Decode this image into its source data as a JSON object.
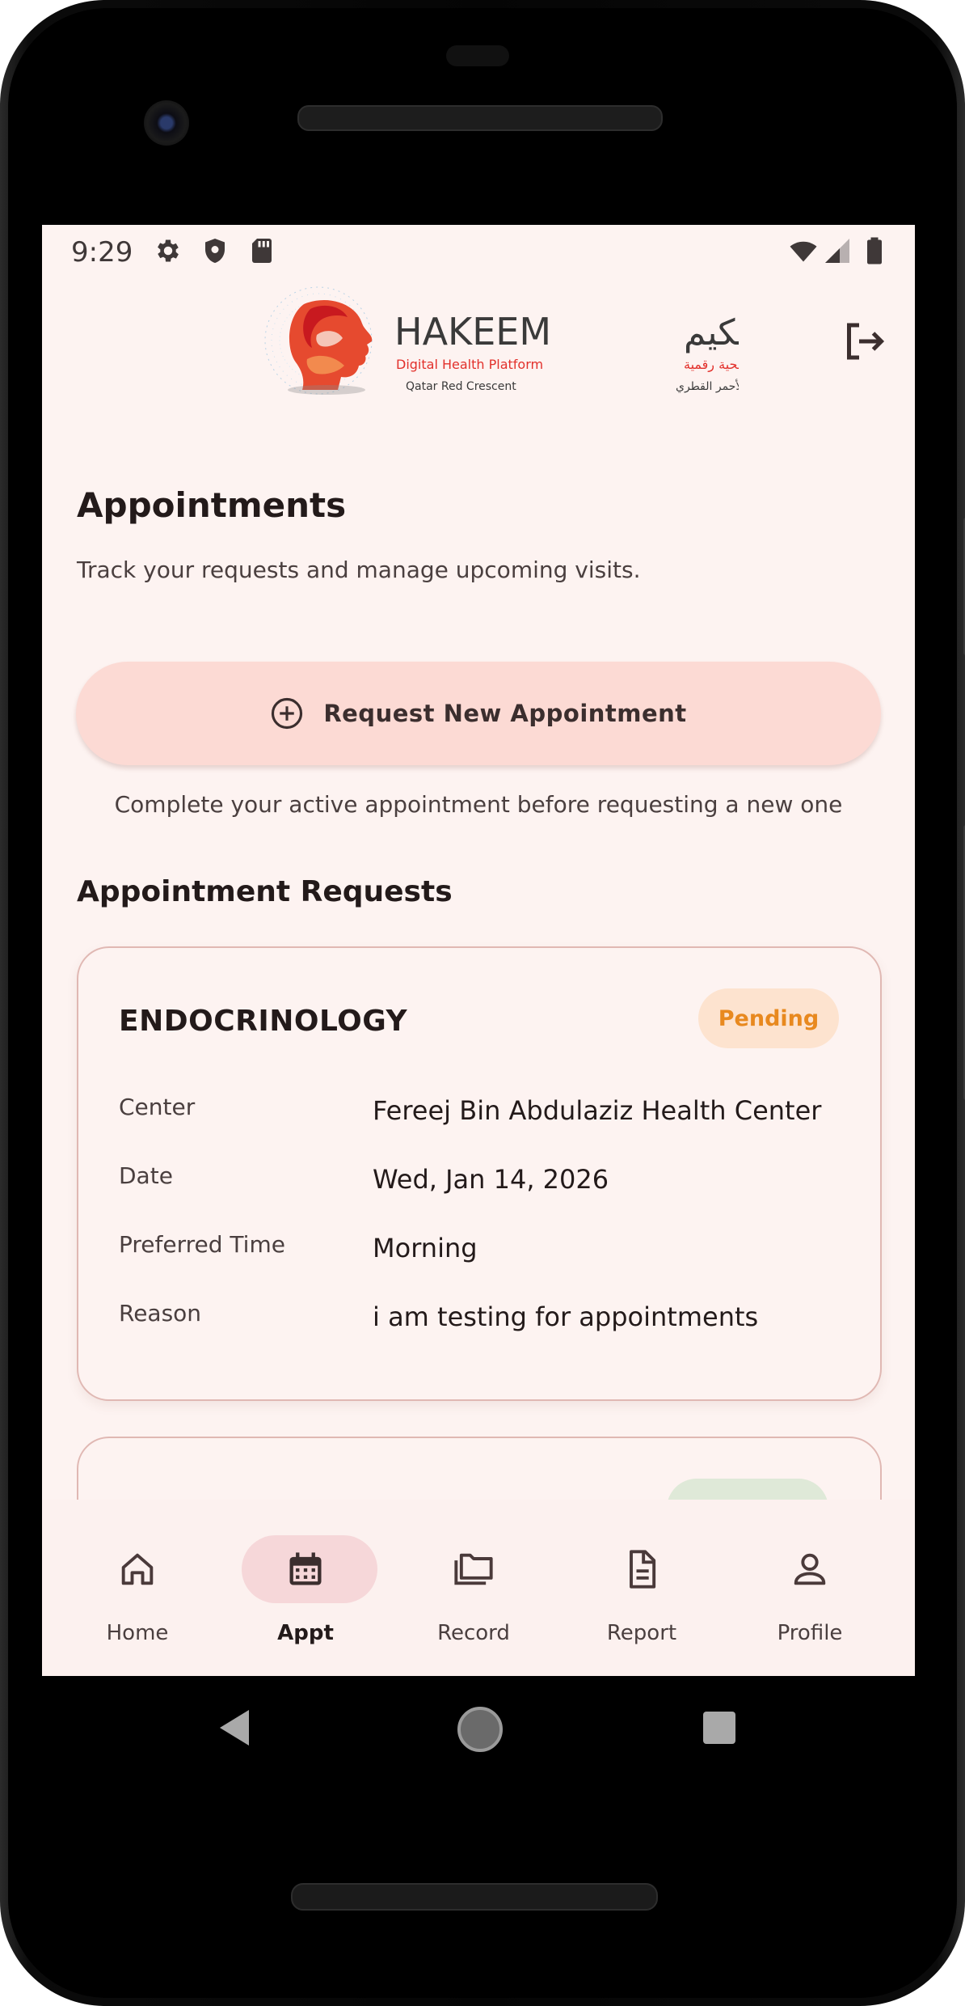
{
  "status_bar": {
    "time": "9:29",
    "left_icons": [
      "settings-icon",
      "shield-icon",
      "sd-card-icon"
    ],
    "right_icons": [
      "wifi-icon",
      "signal-icon",
      "battery-icon"
    ]
  },
  "header": {
    "logo": {
      "name_en": "HAKEEM",
      "name_ar": "حكيم",
      "tagline_en": "Digital Health Platform",
      "tagline_ar": "منصة صحية رقمية",
      "org_en": "Qatar Red Crescent",
      "org_ar": "الهلال الأحمر القطري"
    },
    "logout_icon": "logout-icon"
  },
  "page": {
    "title": "Appointments",
    "subtitle": "Track your requests and manage upcoming visits.",
    "request_button_label": "Request New Appointment",
    "notice": "Complete your active appointment before requesting a new one",
    "section_title": "Appointment Requests"
  },
  "appointments": [
    {
      "department": "ENDOCRINOLOGY",
      "status": "Pending",
      "rows": [
        {
          "label": "Center",
          "value": "Fereej Bin Abdulaziz Health Center"
        },
        {
          "label": "Date",
          "value": "Wed, Jan 14, 2026"
        },
        {
          "label": "Preferred Time",
          "value": "Morning"
        },
        {
          "label": "Reason",
          "value": "i am testing for appointments"
        }
      ]
    }
  ],
  "nav": {
    "items": [
      {
        "label": "Home",
        "icon": "home-icon"
      },
      {
        "label": "Appt",
        "icon": "calendar-icon",
        "active": true
      },
      {
        "label": "Record",
        "icon": "folder-icon"
      },
      {
        "label": "Report",
        "icon": "document-icon"
      },
      {
        "label": "Profile",
        "icon": "person-icon"
      }
    ]
  },
  "colors": {
    "screen_bg": "#fdf3f1",
    "primary_pill": "#fcdad4",
    "pending_bg": "#fde3cf",
    "pending_text": "#e8891f",
    "nav_active_pill": "#f6d7d9",
    "brand_red": "#e2302b"
  }
}
